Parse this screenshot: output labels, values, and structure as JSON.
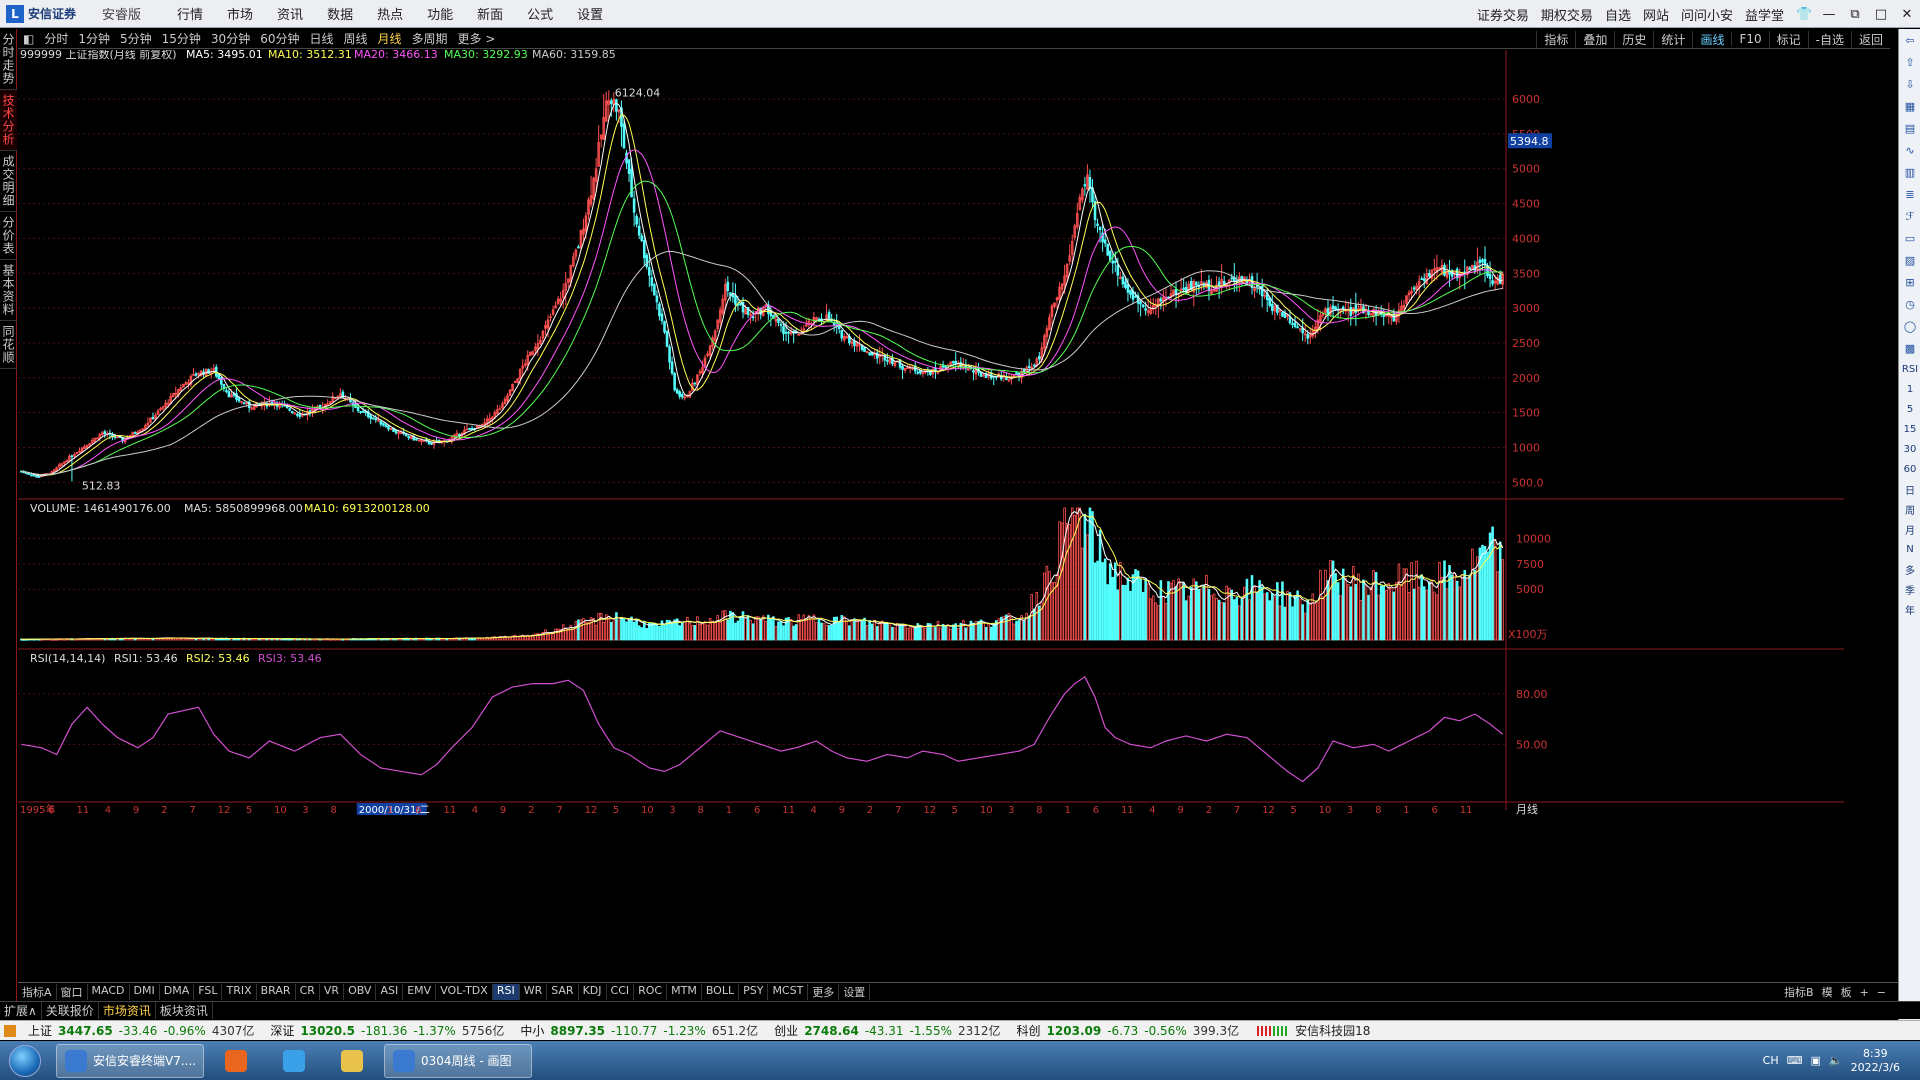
{
  "titlebar": {
    "brand": "安信证券",
    "edition": "安睿版",
    "menus": [
      "行情",
      "市场",
      "资讯",
      "数据",
      "热点",
      "功能",
      "新面",
      "公式",
      "设置"
    ],
    "right_links": [
      "证券交易",
      "期权交易",
      "自选",
      "网站",
      "问问小安",
      "益学堂"
    ],
    "window_controls": [
      "shirt-icon",
      "minimize",
      "restore",
      "maximize",
      "close"
    ]
  },
  "toolbar": {
    "periods": [
      "分时",
      "1分钟",
      "5分钟",
      "15分钟",
      "30分钟",
      "60分钟",
      "日线",
      "周线",
      "月线",
      "多周期",
      "更多 >"
    ],
    "active_period": "月线",
    "right_tools": [
      "指标",
      "叠加",
      "历史",
      "统计",
      "画线",
      "F10",
      "标记",
      "-自选",
      "返回"
    ],
    "active_tool": "画线"
  },
  "left_tabs": [
    "分时走势",
    "技术分析",
    "成交明细",
    "分价表",
    "基本资料",
    "同花顺"
  ],
  "active_left_tab": "技术分析",
  "right_icons": [
    "arrow-left-icon",
    "arrow-up-icon",
    "arrow-down-icon",
    "table-icon",
    "grid-icon",
    "line-icon",
    "candle-icon",
    "list-icon",
    "f-icon",
    "doc-icon",
    "chart2-icon",
    "fq-icon",
    "clock-icon",
    "circle-icon",
    "chart3-icon"
  ],
  "right_text_icons": [
    "RSI",
    "1",
    "5",
    "15",
    "30",
    "60",
    "日",
    "周",
    "月",
    "N",
    "多",
    "季",
    "年"
  ],
  "main_info": {
    "symbol": "999999 上证指数(月线 前复权)",
    "ma5": "MA5: 3495.01",
    "ma10": "MA10: 3512.31",
    "ma20": "MA20: 3466.13",
    "ma30": "MA30: 3292.93",
    "ma60": "MA60: 3159.85",
    "high_label": "6124.04",
    "low_label": "512.83",
    "current_price": "5394.8"
  },
  "volume_info": {
    "label": "VOLUME: 1461490176.00",
    "ma5": "MA5: 5850899968.00",
    "ma10": "MA10: 6913200128.00",
    "unit": "X100万"
  },
  "rsi_info": {
    "label": "RSI(14,14,14)",
    "rsi1": "RSI1: 53.46",
    "rsi2": "RSI2: 53.46",
    "rsi3": "RSI3: 53.46"
  },
  "chart_data": {
    "type": "candlestick",
    "title": "999999 上证指数(月线 前复权)",
    "y_ticks": [
      "6000",
      "5500",
      "5000",
      "4500",
      "4000",
      "3500",
      "3000",
      "2500",
      "2000",
      "1500",
      "1000",
      "500.0"
    ],
    "y_tick_values": [
      6000,
      5500,
      5000,
      4500,
      4000,
      3500,
      3000,
      2500,
      2000,
      1500,
      1000,
      500
    ],
    "ylim": [
      390,
      6130
    ],
    "vol_ticks": [
      "10000",
      "7500",
      "5000"
    ],
    "vol_tick_values": [
      10000,
      7500,
      5000
    ],
    "vol_ylim": [
      0,
      13000
    ],
    "rsi_ticks": [
      "80.00",
      "50.00"
    ],
    "rsi_tick_values": [
      80,
      50
    ],
    "rsi_ylim": [
      20,
      100
    ],
    "x_ticks": [
      "1995年",
      "6",
      "11",
      "4",
      "9",
      "2",
      "7",
      "12",
      "5",
      "10",
      "3",
      "8",
      "2000/10/31/二",
      "1",
      "6",
      "11",
      "4",
      "9",
      "2",
      "7",
      "12",
      "5",
      "10",
      "3",
      "8",
      "1",
      "6",
      "11",
      "4",
      "9",
      "2",
      "7",
      "12",
      "5",
      "10",
      "3",
      "8",
      "1",
      "6",
      "11",
      "4",
      "9",
      "2",
      "7",
      "12",
      "5",
      "10",
      "3",
      "8",
      "1",
      "6",
      "11"
    ],
    "keypoints": [
      [
        0,
        660
      ],
      [
        6,
        580
      ],
      [
        12,
        640
      ],
      [
        18,
        830
      ],
      [
        25,
        1020
      ],
      [
        32,
        1210
      ],
      [
        40,
        1110
      ],
      [
        48,
        1290
      ],
      [
        56,
        1580
      ],
      [
        63,
        1870
      ],
      [
        70,
        2080
      ],
      [
        76,
        2100
      ],
      [
        82,
        1760
      ],
      [
        90,
        1590
      ],
      [
        100,
        1640
      ],
      [
        110,
        1470
      ],
      [
        118,
        1570
      ],
      [
        126,
        1780
      ],
      [
        132,
        1560
      ],
      [
        140,
        1400
      ],
      [
        148,
        1220
      ],
      [
        156,
        1110
      ],
      [
        162,
        1060
      ],
      [
        168,
        1100
      ],
      [
        175,
        1240
      ],
      [
        182,
        1310
      ],
      [
        190,
        1600
      ],
      [
        198,
        2160
      ],
      [
        206,
        2650
      ],
      [
        214,
        3240
      ],
      [
        220,
        3900
      ],
      [
        226,
        4850
      ],
      [
        230,
        5700
      ],
      [
        232,
        6090
      ],
      [
        236,
        5800
      ],
      [
        242,
        4390
      ],
      [
        248,
        3480
      ],
      [
        254,
        2660
      ],
      [
        258,
        1820
      ],
      [
        262,
        1700
      ],
      [
        268,
        2080
      ],
      [
        274,
        2700
      ],
      [
        278,
        3300
      ],
      [
        283,
        3050
      ],
      [
        288,
        2880
      ],
      [
        294,
        3010
      ],
      [
        300,
        2700
      ],
      [
        306,
        2600
      ],
      [
        312,
        2800
      ],
      [
        318,
        2870
      ],
      [
        324,
        2620
      ],
      [
        330,
        2480
      ],
      [
        336,
        2330
      ],
      [
        342,
        2290
      ],
      [
        348,
        2160
      ],
      [
        354,
        2110
      ],
      [
        360,
        2080
      ],
      [
        366,
        2200
      ],
      [
        372,
        2180
      ],
      [
        378,
        2050
      ],
      [
        384,
        2030
      ],
      [
        390,
        2000
      ],
      [
        396,
        2080
      ],
      [
        402,
        2270
      ],
      [
        407,
        2980
      ],
      [
        412,
        3450
      ],
      [
        415,
        3950
      ],
      [
        418,
        4620
      ],
      [
        421,
        4820
      ],
      [
        424,
        4250
      ],
      [
        428,
        3900
      ],
      [
        432,
        3600
      ],
      [
        436,
        3300
      ],
      [
        440,
        3120
      ],
      [
        446,
        2980
      ],
      [
        452,
        3180
      ],
      [
        458,
        3250
      ],
      [
        464,
        3350
      ],
      [
        470,
        3310
      ],
      [
        476,
        3370
      ],
      [
        482,
        3450
      ],
      [
        488,
        3280
      ],
      [
        494,
        3020
      ],
      [
        500,
        2880
      ],
      [
        504,
        2730
      ],
      [
        508,
        2600
      ],
      [
        513,
        2870
      ],
      [
        518,
        3020
      ],
      [
        524,
        2940
      ],
      [
        530,
        2980
      ],
      [
        536,
        2930
      ],
      [
        542,
        2840
      ],
      [
        548,
        3220
      ],
      [
        554,
        3460
      ],
      [
        560,
        3560
      ],
      [
        566,
        3470
      ],
      [
        572,
        3580
      ],
      [
        577,
        3640
      ],
      [
        581,
        3340
      ],
      [
        585,
        3447
      ]
    ],
    "candle_count": 586,
    "volume_keypoints": [
      [
        0,
        80
      ],
      [
        60,
        180
      ],
      [
        120,
        100
      ],
      [
        180,
        180
      ],
      [
        200,
        420
      ],
      [
        215,
        1250
      ],
      [
        225,
        1800
      ],
      [
        232,
        2400
      ],
      [
        240,
        2000
      ],
      [
        250,
        1350
      ],
      [
        260,
        1700
      ],
      [
        270,
        1900
      ],
      [
        280,
        2350
      ],
      [
        290,
        2100
      ],
      [
        300,
        1750
      ],
      [
        315,
        2100
      ],
      [
        330,
        1800
      ],
      [
        345,
        1500
      ],
      [
        360,
        1450
      ],
      [
        380,
        1650
      ],
      [
        395,
        2200
      ],
      [
        405,
        5800
      ],
      [
        412,
        10900
      ],
      [
        416,
        12500
      ],
      [
        420,
        11300
      ],
      [
        428,
        7500
      ],
      [
        436,
        6000
      ],
      [
        446,
        4800
      ],
      [
        456,
        4700
      ],
      [
        470,
        5000
      ],
      [
        480,
        4700
      ],
      [
        490,
        5100
      ],
      [
        500,
        4400
      ],
      [
        508,
        3400
      ],
      [
        514,
        5800
      ],
      [
        520,
        6300
      ],
      [
        530,
        5400
      ],
      [
        540,
        5600
      ],
      [
        550,
        6000
      ],
      [
        560,
        5900
      ],
      [
        570,
        6600
      ],
      [
        578,
        8300
      ],
      [
        582,
        8800
      ],
      [
        585,
        7300
      ]
    ],
    "rsi_keypoints": [
      [
        0,
        50
      ],
      [
        8,
        48
      ],
      [
        14,
        44
      ],
      [
        20,
        62
      ],
      [
        26,
        72
      ],
      [
        32,
        62
      ],
      [
        38,
        54
      ],
      [
        46,
        48
      ],
      [
        52,
        54
      ],
      [
        58,
        68
      ],
      [
        64,
        70
      ],
      [
        70,
        72
      ],
      [
        76,
        56
      ],
      [
        82,
        46
      ],
      [
        90,
        42
      ],
      [
        98,
        52
      ],
      [
        108,
        46
      ],
      [
        118,
        54
      ],
      [
        126,
        56
      ],
      [
        134,
        44
      ],
      [
        142,
        36
      ],
      [
        150,
        34
      ],
      [
        158,
        32
      ],
      [
        164,
        38
      ],
      [
        170,
        48
      ],
      [
        178,
        60
      ],
      [
        186,
        78
      ],
      [
        194,
        84
      ],
      [
        202,
        86
      ],
      [
        210,
        86
      ],
      [
        216,
        88
      ],
      [
        222,
        82
      ],
      [
        228,
        62
      ],
      [
        234,
        48
      ],
      [
        240,
        44
      ],
      [
        248,
        36
      ],
      [
        254,
        34
      ],
      [
        260,
        38
      ],
      [
        268,
        48
      ],
      [
        276,
        58
      ],
      [
        284,
        54
      ],
      [
        292,
        50
      ],
      [
        300,
        46
      ],
      [
        306,
        48
      ],
      [
        314,
        52
      ],
      [
        320,
        46
      ],
      [
        326,
        42
      ],
      [
        334,
        40
      ],
      [
        342,
        44
      ],
      [
        350,
        42
      ],
      [
        356,
        46
      ],
      [
        364,
        44
      ],
      [
        370,
        40
      ],
      [
        378,
        42
      ],
      [
        386,
        44
      ],
      [
        394,
        46
      ],
      [
        400,
        50
      ],
      [
        406,
        66
      ],
      [
        412,
        80
      ],
      [
        416,
        86
      ],
      [
        420,
        90
      ],
      [
        424,
        78
      ],
      [
        428,
        60
      ],
      [
        432,
        54
      ],
      [
        438,
        50
      ],
      [
        446,
        48
      ],
      [
        452,
        52
      ],
      [
        460,
        55
      ],
      [
        468,
        52
      ],
      [
        476,
        56
      ],
      [
        484,
        54
      ],
      [
        492,
        44
      ],
      [
        500,
        34
      ],
      [
        506,
        28
      ],
      [
        512,
        36
      ],
      [
        518,
        52
      ],
      [
        526,
        48
      ],
      [
        534,
        50
      ],
      [
        540,
        46
      ],
      [
        548,
        52
      ],
      [
        556,
        58
      ],
      [
        562,
        66
      ],
      [
        568,
        64
      ],
      [
        574,
        68
      ],
      [
        580,
        62
      ],
      [
        585,
        56
      ]
    ],
    "high_index": 232,
    "low_index": 20
  },
  "bottom_tabs": [
    "指标A",
    "窗口",
    "MACD",
    "DMI",
    "DMA",
    "FSL",
    "TRIX",
    "BRAR",
    "CR",
    "VR",
    "OBV",
    "ASI",
    "EMV",
    "VOL-TDX",
    "RSI",
    "WR",
    "SAR",
    "KDJ",
    "CCI",
    "ROC",
    "MTM",
    "BOLL",
    "PSY",
    "MCST",
    "更多",
    "设置"
  ],
  "active_bottom_tab": "RSI",
  "bottom_right": [
    "指标B",
    "模",
    "板",
    "+",
    "−"
  ],
  "ext_tabs": [
    "扩展∧",
    "关联报价",
    "市场资讯",
    "板块资讯"
  ],
  "active_ext_tab": "市场资讯",
  "period_label": "月线",
  "ticker": [
    {
      "name": "上证",
      "value": "3447.65",
      "change": "-33.46",
      "pct": "-0.96%",
      "amount": "4307亿"
    },
    {
      "name": "深证",
      "value": "13020.5",
      "change": "-181.36",
      "pct": "-1.37%",
      "amount": "5756亿"
    },
    {
      "name": "中小",
      "value": "8897.35",
      "change": "-110.77",
      "pct": "-1.23%",
      "amount": "651.2亿"
    },
    {
      "name": "创业",
      "value": "2748.64",
      "change": "-43.31",
      "pct": "-1.55%",
      "amount": "2312亿"
    },
    {
      "name": "科创",
      "value": "1203.09",
      "change": "-6.73",
      "pct": "-0.56%",
      "amount": "399.3亿"
    }
  ],
  "ticker_extra": "安信科技园18",
  "taskbar": {
    "tasks": [
      {
        "label": "安信安睿终端V7....",
        "type": "big"
      },
      {
        "label": "",
        "type": "small",
        "icon": "firefox-icon"
      },
      {
        "label": "",
        "type": "small",
        "icon": "cloud-icon"
      },
      {
        "label": "",
        "type": "small",
        "icon": "folder-icon"
      },
      {
        "label": "0304周线 - 画图",
        "type": "big"
      }
    ],
    "clock_time": "8:39",
    "clock_date": "2022/3/6",
    "tray_lang": "CH"
  },
  "colors": {
    "up": "#ff5050",
    "down": "#54ffff",
    "ma5": "#ffffff",
    "ma10": "#ffff55",
    "ma20": "#ff55ff",
    "ma30": "#55ff55",
    "ma60": "#cccccc",
    "rsi": "#d050d0",
    "axis": "#8b1c1c"
  }
}
